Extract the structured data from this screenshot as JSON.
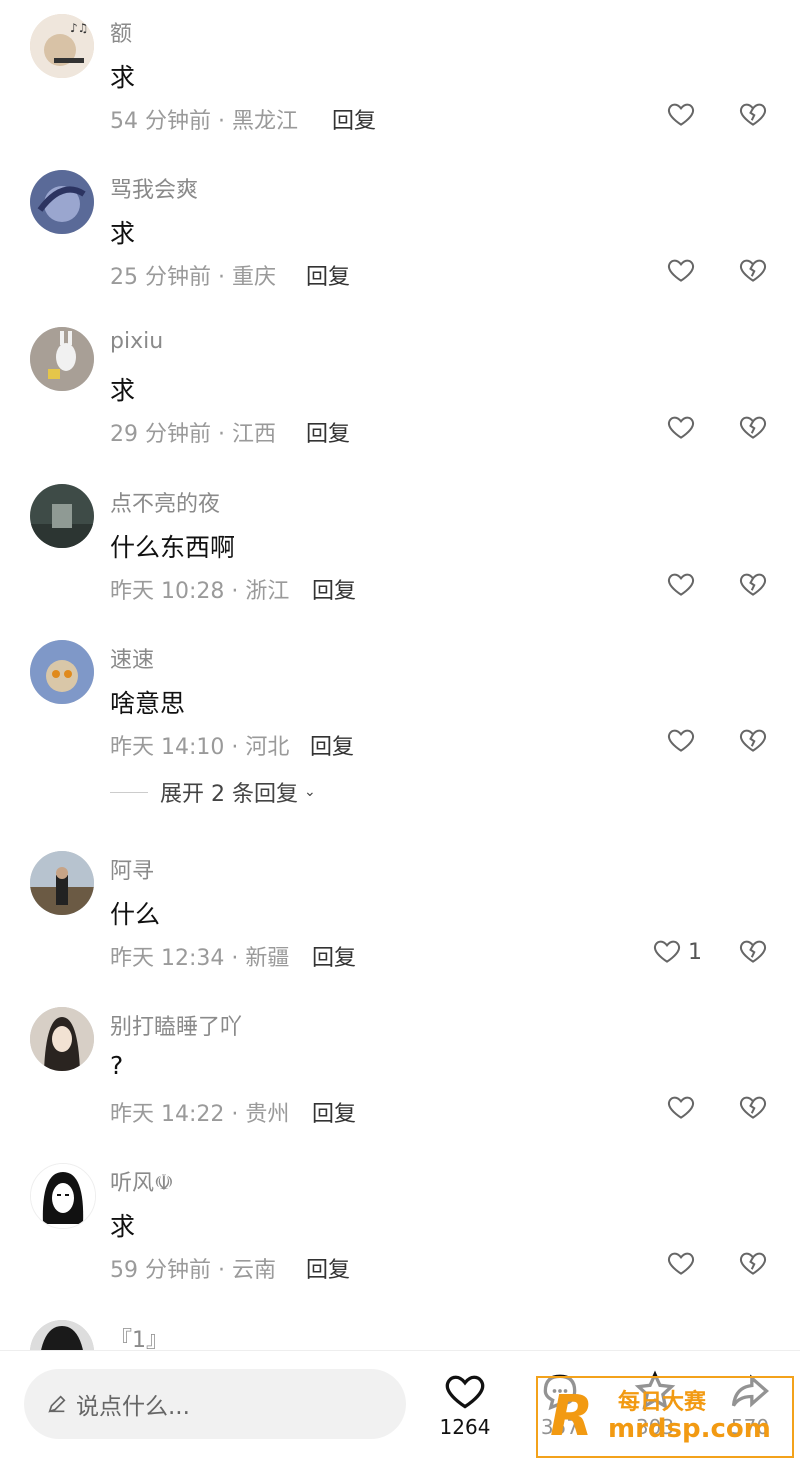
{
  "comments": [
    {
      "username": "额",
      "text": "求",
      "time": "54 分钟前 · 黑龙江",
      "reply": "回复",
      "avatar_color": "#e9d7c4"
    },
    {
      "username": "骂我会爽",
      "text": "求",
      "time": "25 分钟前 · 重庆",
      "reply": "回复",
      "avatar_color": "#6f7fa8"
    },
    {
      "username": "pixiu",
      "text": "求",
      "time": "29 分钟前 · 江西",
      "reply": "回复",
      "avatar_color": "#b8b2ab"
    },
    {
      "username": "点不亮的夜",
      "text": "什么东西啊",
      "time": "昨天 10:28 · 浙江",
      "reply": "回复",
      "avatar_color": "#4c5a55"
    },
    {
      "username": "速速",
      "text": "啥意思",
      "time": "昨天 14:10 · 河北",
      "reply": "回复",
      "avatar_color": "#7e95c4"
    },
    {
      "username": "阿寻",
      "text": "什么",
      "time": "昨天 12:34 · 新疆",
      "reply": "回复",
      "like_count": "1",
      "avatar_color": "#5b5142"
    },
    {
      "username": "别打瞌睡了吖",
      "text": "?",
      "time": "昨天 14:22 · 贵州",
      "reply": "回复",
      "avatar_color": "#d2c7bd"
    },
    {
      "username": "听风☫",
      "text": "求",
      "time": "59 分钟前 · 云南",
      "reply": "回复",
      "avatar_color": "#ffffff"
    },
    {
      "username": "『1』",
      "avatar_color": "#222222"
    }
  ],
  "expand_replies": "展开 2 条回复",
  "bottom_bar": {
    "input_placeholder": "说点什么...",
    "likes": "1264",
    "comments": "357",
    "favorites": "303",
    "shares": "570"
  },
  "watermark": {
    "logo": "R",
    "name": "每日大赛",
    "url": "mrdsp.com"
  },
  "colors": {
    "accent": "#f29a12",
    "meta": "#9a9a9a"
  },
  "icons": [
    "heart-icon",
    "broken-heart-icon",
    "pencil-icon",
    "chat-bubble-icon",
    "star-icon",
    "share-arrow-icon",
    "chevron-down-icon"
  ]
}
